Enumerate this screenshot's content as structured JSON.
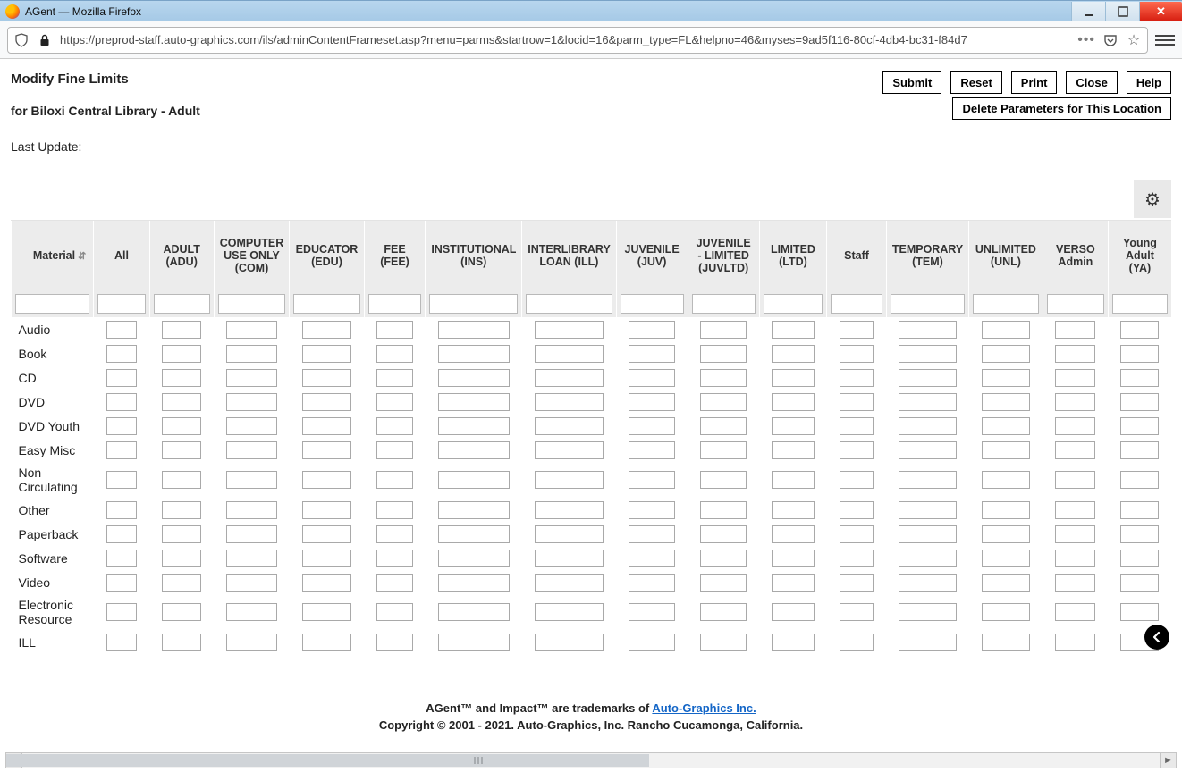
{
  "window": {
    "title": "AGent — Mozilla Firefox"
  },
  "url": "https://preprod-staff.auto-graphics.com/ils/adminContentFrameset.asp?menu=parms&startrow=1&locid=16&parm_type=FL&helpno=46&myses=9ad5f116-80cf-4db4-bc31-f84d7",
  "header": {
    "title": "Modify Fine Limits",
    "subtitle": "for Biloxi Central Library - Adult",
    "last_update_label": "Last Update:",
    "buttons": {
      "submit": "Submit",
      "reset": "Reset",
      "print": "Print",
      "close": "Close",
      "help": "Help"
    },
    "delete_btn": "Delete Parameters for This Location"
  },
  "columns": [
    {
      "key": "material",
      "label": "Material"
    },
    {
      "key": "all",
      "label": "All"
    },
    {
      "key": "adult",
      "label": "ADULT (ADU)"
    },
    {
      "key": "computer",
      "label": "COMPUTER USE ONLY (COM)"
    },
    {
      "key": "educator",
      "label": "EDUCATOR (EDU)"
    },
    {
      "key": "fee",
      "label": "FEE (FEE)"
    },
    {
      "key": "institutional",
      "label": "INSTITUTIONAL (INS)"
    },
    {
      "key": "interlibrary",
      "label": "INTERLIBRARY LOAN (ILL)"
    },
    {
      "key": "juvenile",
      "label": "JUVENILE (JUV)"
    },
    {
      "key": "juvltd",
      "label": "JUVENILE - LIMITED (JUVLTD)"
    },
    {
      "key": "limited",
      "label": "LIMITED (LTD)"
    },
    {
      "key": "staff",
      "label": "Staff"
    },
    {
      "key": "temporary",
      "label": "TEMPORARY (TEM)"
    },
    {
      "key": "unlimited",
      "label": "UNLIMITED (UNL)"
    },
    {
      "key": "verso",
      "label": "VERSO Admin"
    },
    {
      "key": "youngadult",
      "label": "Young Adult (YA)"
    }
  ],
  "rows": [
    "Audio",
    "Book",
    "CD",
    "DVD",
    "DVD Youth",
    "Easy Misc",
    "Non Circulating",
    "Other",
    "Paperback",
    "Software",
    "Video",
    "Electronic Resource",
    "ILL"
  ],
  "footer": {
    "line1a": "AGent™ and Impact™ are trademarks of ",
    "link": "Auto-Graphics Inc.",
    "line2": "Copyright © 2001 - 2021. Auto-Graphics, Inc. Rancho Cucamonga, California."
  }
}
